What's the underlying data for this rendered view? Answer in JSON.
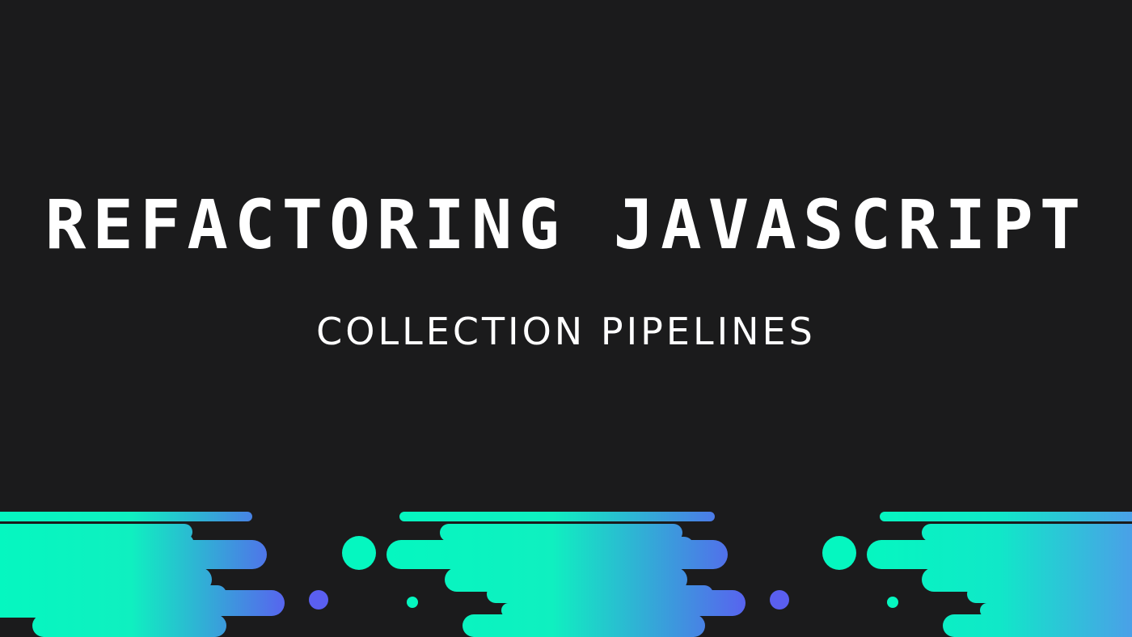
{
  "title": "REFACTORING JAVASCRIPT",
  "subtitle": "COLLECTION PIPELINES",
  "colors": {
    "background": "#1b1b1c",
    "text": "#ffffff",
    "accent_mint": "#05f7c0",
    "accent_violet": "#5a5ff0"
  },
  "decoration": "speed-lines-pattern"
}
